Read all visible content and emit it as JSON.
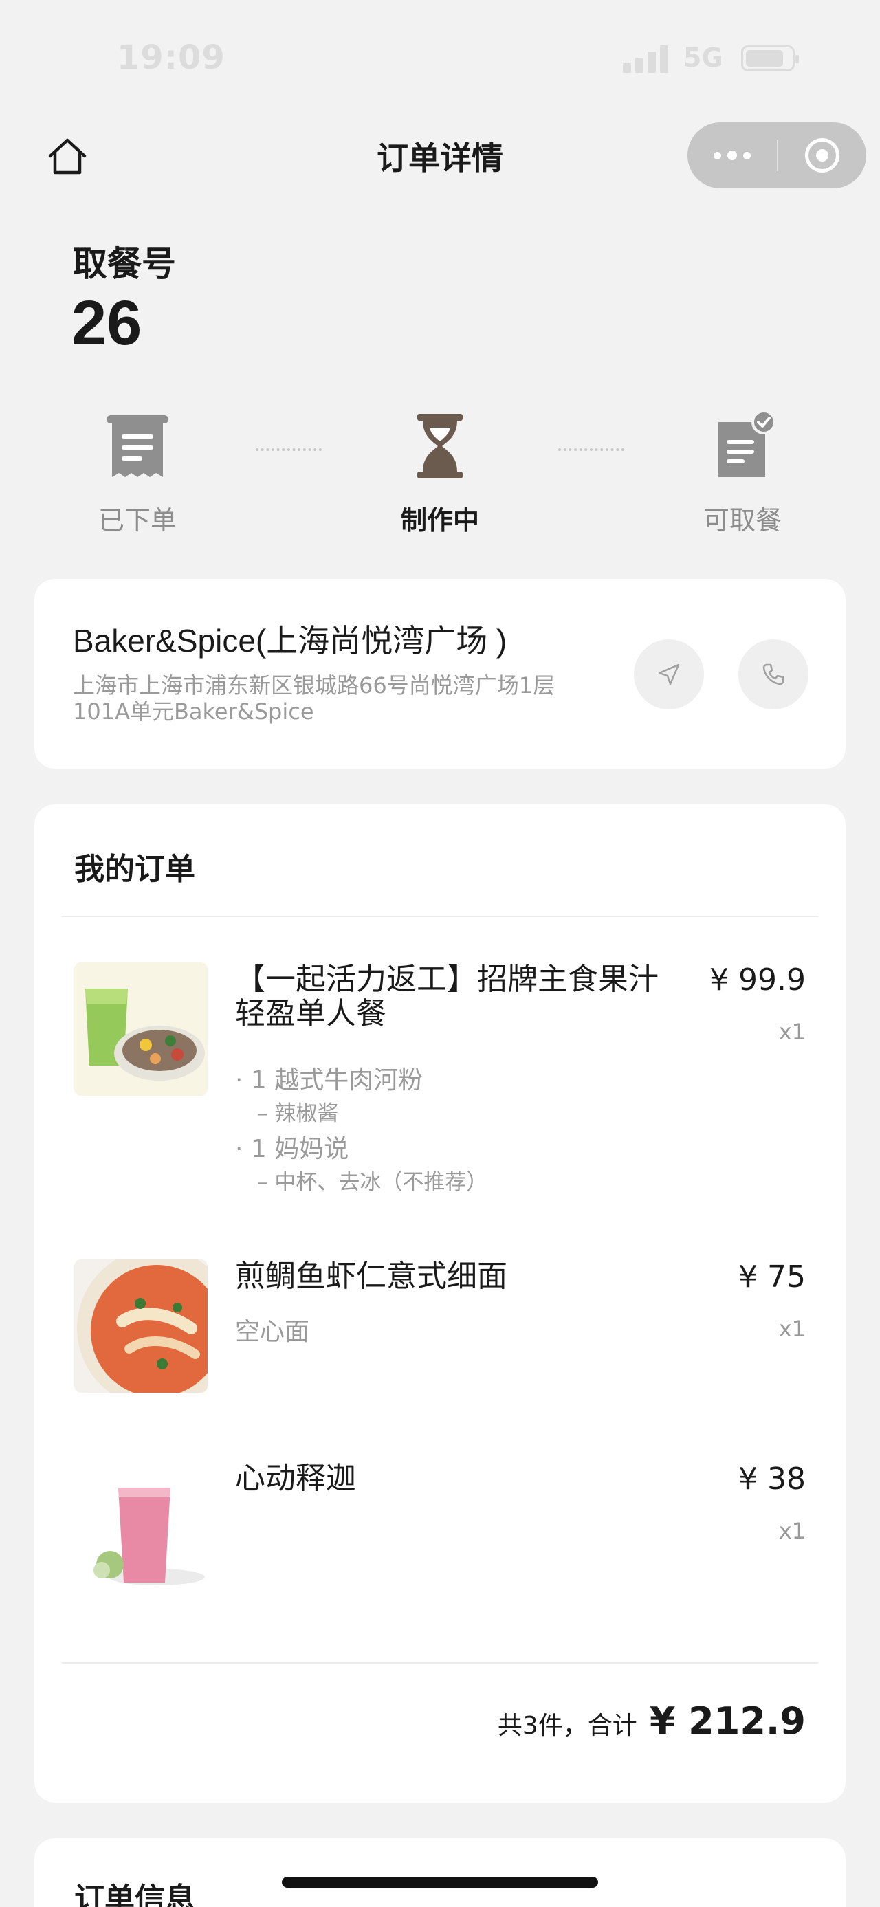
{
  "status_bar": {
    "time": "19:09",
    "network": "5G"
  },
  "nav": {
    "title": "订单详情"
  },
  "pickup": {
    "label": "取餐号",
    "number": "26"
  },
  "progress": {
    "current_step": 1,
    "steps": [
      {
        "label": "已下单",
        "icon": "receipt-icon"
      },
      {
        "label": "制作中",
        "icon": "hourglass-icon"
      },
      {
        "label": "可取餐",
        "icon": "ready-document-icon"
      }
    ]
  },
  "store": {
    "name": "Baker&Spice(上海尚悦湾广场 )",
    "address": "上海市上海市浦东新区银城路66号尚悦湾广场1层101A单元Baker&Spice",
    "navigate_icon": "navigate-arrow-icon",
    "call_icon": "phone-icon"
  },
  "order": {
    "title": "我的订单",
    "items": [
      {
        "name": "【一起活力返工】招牌主食果汁轻盈单人餐",
        "price": "¥ 99.9",
        "qty": "x1",
        "subitems": [
          {
            "text": "· 1 越式牛肉河粉",
            "note": "– 辣椒酱"
          },
          {
            "text": "· 1 妈妈说",
            "note": "– 中杯、去冰（不推荐）"
          }
        ]
      },
      {
        "name": "煎鲷鱼虾仁意式细面",
        "price": "¥ 75",
        "qty": "x1",
        "spec": "空心面"
      },
      {
        "name": "心动释迦",
        "price": "¥ 38",
        "qty": "x1"
      }
    ],
    "total_label": "共3件，合计",
    "total_amount": "¥ 212.9"
  },
  "info": {
    "title": "订单信息"
  },
  "colors": {
    "background": "#f2f2f2",
    "card": "#ffffff",
    "accent": "#6b5a4e",
    "muted": "#9a9a9a"
  }
}
